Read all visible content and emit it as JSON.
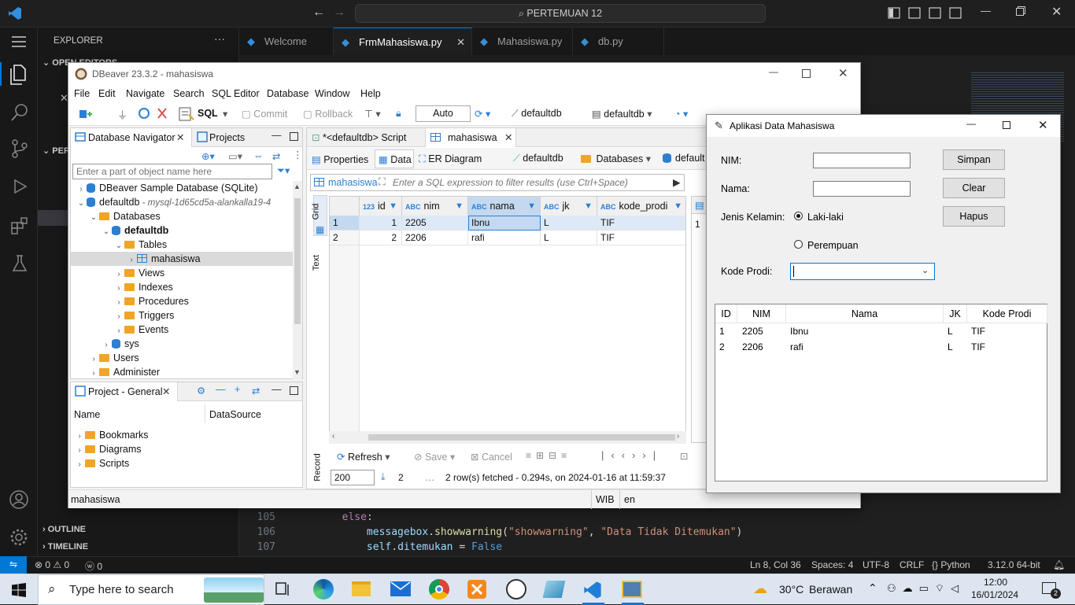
{
  "vscode": {
    "search_text": "PERTEMUAN 12",
    "explorer_label": "EXPLORER",
    "open_editors_label": "OPEN EDITORS",
    "pertemuan_label": "PER",
    "outline_label": "OUTLINE",
    "timeline_label": "TIMELINE",
    "tabs": [
      {
        "label": "Welcome",
        "active": false
      },
      {
        "label": "FrmMahasiswa.py",
        "active": true
      },
      {
        "label": "Mahasiswa.py",
        "active": false
      },
      {
        "label": "db.py",
        "active": false
      }
    ],
    "code": [
      {
        "line": "105",
        "text": "        else:"
      },
      {
        "line": "106",
        "text": "            messagebox.showwarning(\"showwarning\", \"Data Tidak Ditemukan\")"
      },
      {
        "line": "107",
        "text": "            self.ditemukan = False"
      }
    ],
    "status": {
      "errors": "0",
      "warnings": "0",
      "ports": "0",
      "cursor": "Ln 8, Col 36",
      "spaces": "Spaces: 4",
      "encoding": "UTF-8",
      "eol": "CRLF",
      "language": "Python",
      "interpreter": "3.12.0 64-bit"
    }
  },
  "dbeaver": {
    "title": "DBeaver 23.3.2 - mahasiswa",
    "menu": [
      "File",
      "Edit",
      "Navigate",
      "Search",
      "SQL Editor",
      "Database",
      "Window",
      "Help"
    ],
    "toolbar": {
      "sql": "SQL",
      "commit": "Commit",
      "rollback": "Rollback",
      "mode": "Auto",
      "datasource": "defaultdb",
      "schema": "defaultdb"
    },
    "navigator": {
      "tab_label": "Database Navigator",
      "projects_tab": "Projects",
      "filter_placeholder": "Enter a part of object name here",
      "tree": [
        {
          "label": "DBeaver Sample Database (SQLite)",
          "indent": 0,
          "icon": "db",
          "arrow": "›"
        },
        {
          "label": "defaultdb",
          "extra": " - mysql-1d65cd5a-alankalla19-4",
          "indent": 0,
          "icon": "db",
          "arrow": "⌄"
        },
        {
          "label": "Databases",
          "indent": 1,
          "icon": "folder",
          "arrow": "⌄"
        },
        {
          "label": "defaultdb",
          "indent": 2,
          "icon": "db",
          "arrow": "⌄",
          "bold": true
        },
        {
          "label": "Tables",
          "indent": 3,
          "icon": "folder",
          "arrow": "⌄"
        },
        {
          "label": "mahasiswa",
          "indent": 4,
          "icon": "table",
          "arrow": "›",
          "selected": true
        },
        {
          "label": "Views",
          "indent": 3,
          "icon": "folder",
          "arrow": "›"
        },
        {
          "label": "Indexes",
          "indent": 3,
          "icon": "folder",
          "arrow": "›"
        },
        {
          "label": "Procedures",
          "indent": 3,
          "icon": "folder",
          "arrow": "›"
        },
        {
          "label": "Triggers",
          "indent": 3,
          "icon": "folder",
          "arrow": "›"
        },
        {
          "label": "Events",
          "indent": 3,
          "icon": "folder",
          "arrow": "›"
        },
        {
          "label": "sys",
          "indent": 2,
          "icon": "db",
          "arrow": "›"
        },
        {
          "label": "Users",
          "indent": 1,
          "icon": "folder",
          "arrow": "›"
        },
        {
          "label": "Administer",
          "indent": 1,
          "icon": "folder",
          "arrow": "›"
        }
      ]
    },
    "project_panel": {
      "tab_label": "Project - General",
      "col_name": "Name",
      "col_datasource": "DataSource",
      "items": [
        "Bookmarks",
        "Diagrams",
        "Scripts"
      ]
    },
    "editor_tabs": [
      "*<defaultdb> Script",
      "mahasiswa"
    ],
    "sub_tabs": [
      "Properties",
      "Data",
      "ER Diagram"
    ],
    "sub_tab_right": [
      "defaultdb",
      "Databases",
      "default"
    ],
    "filter": {
      "table_label": "mahasiswa",
      "placeholder": "Enter a SQL expression to filter results (use Ctrl+Space)"
    },
    "side_tabs": [
      "Grid",
      "Text",
      "Record"
    ],
    "grid": {
      "columns": [
        "id",
        "nim",
        "nama",
        "jk",
        "kode_prodi"
      ],
      "rows": [
        {
          "row": "1",
          "id": "1",
          "nim": "2205",
          "nama": "Ibnu",
          "jk": "L",
          "kode_prodi": "TIF"
        },
        {
          "row": "2",
          "id": "2",
          "nim": "2206",
          "nama": "rafi",
          "jk": "L",
          "kode_prodi": "TIF"
        }
      ],
      "right_panel_value": "1"
    },
    "bottom": {
      "refresh": "Refresh",
      "save": "Save",
      "cancel": "Cancel",
      "limit": "200",
      "count": "2",
      "status": "2 row(s) fetched - 0.294s, on 2024-01-16 at 11:59:37"
    },
    "statusbar": {
      "left": "mahasiswa",
      "tz": "WIB",
      "lang": "en"
    }
  },
  "tkapp": {
    "title": "Aplikasi Data Mahasiswa",
    "nim_label": "NIM:",
    "nama_label": "Nama:",
    "jk_label": "Jenis Kelamin:",
    "radio_laki": "Laki-laki",
    "radio_perempuan": "Perempuan",
    "prodi_label": "Kode Prodi:",
    "btn_simpan": "Simpan",
    "btn_clear": "Clear",
    "btn_hapus": "Hapus",
    "table_headers": [
      "ID",
      "NIM",
      "Nama",
      "JK",
      "Kode Prodi"
    ],
    "table_rows": [
      [
        "1",
        "2205",
        "Ibnu",
        "L",
        "TIF"
      ],
      [
        "2",
        "2206",
        "rafi",
        "L",
        "TIF"
      ]
    ]
  },
  "taskbar": {
    "search_placeholder": "Type here to search",
    "weather_temp": "30°C",
    "weather_text": "Berawan",
    "time": "12:00",
    "date": "16/01/2024",
    "notifications": "2"
  },
  "colors": {
    "vscode_bg": "#1f1f1f",
    "vscode_accent": "#0078d4",
    "dbeaver_select": "#c4d9ef",
    "keyword": "#c586c0",
    "string": "#ce9178",
    "function": "#dcdcaa",
    "variable": "#9cdcfe"
  }
}
